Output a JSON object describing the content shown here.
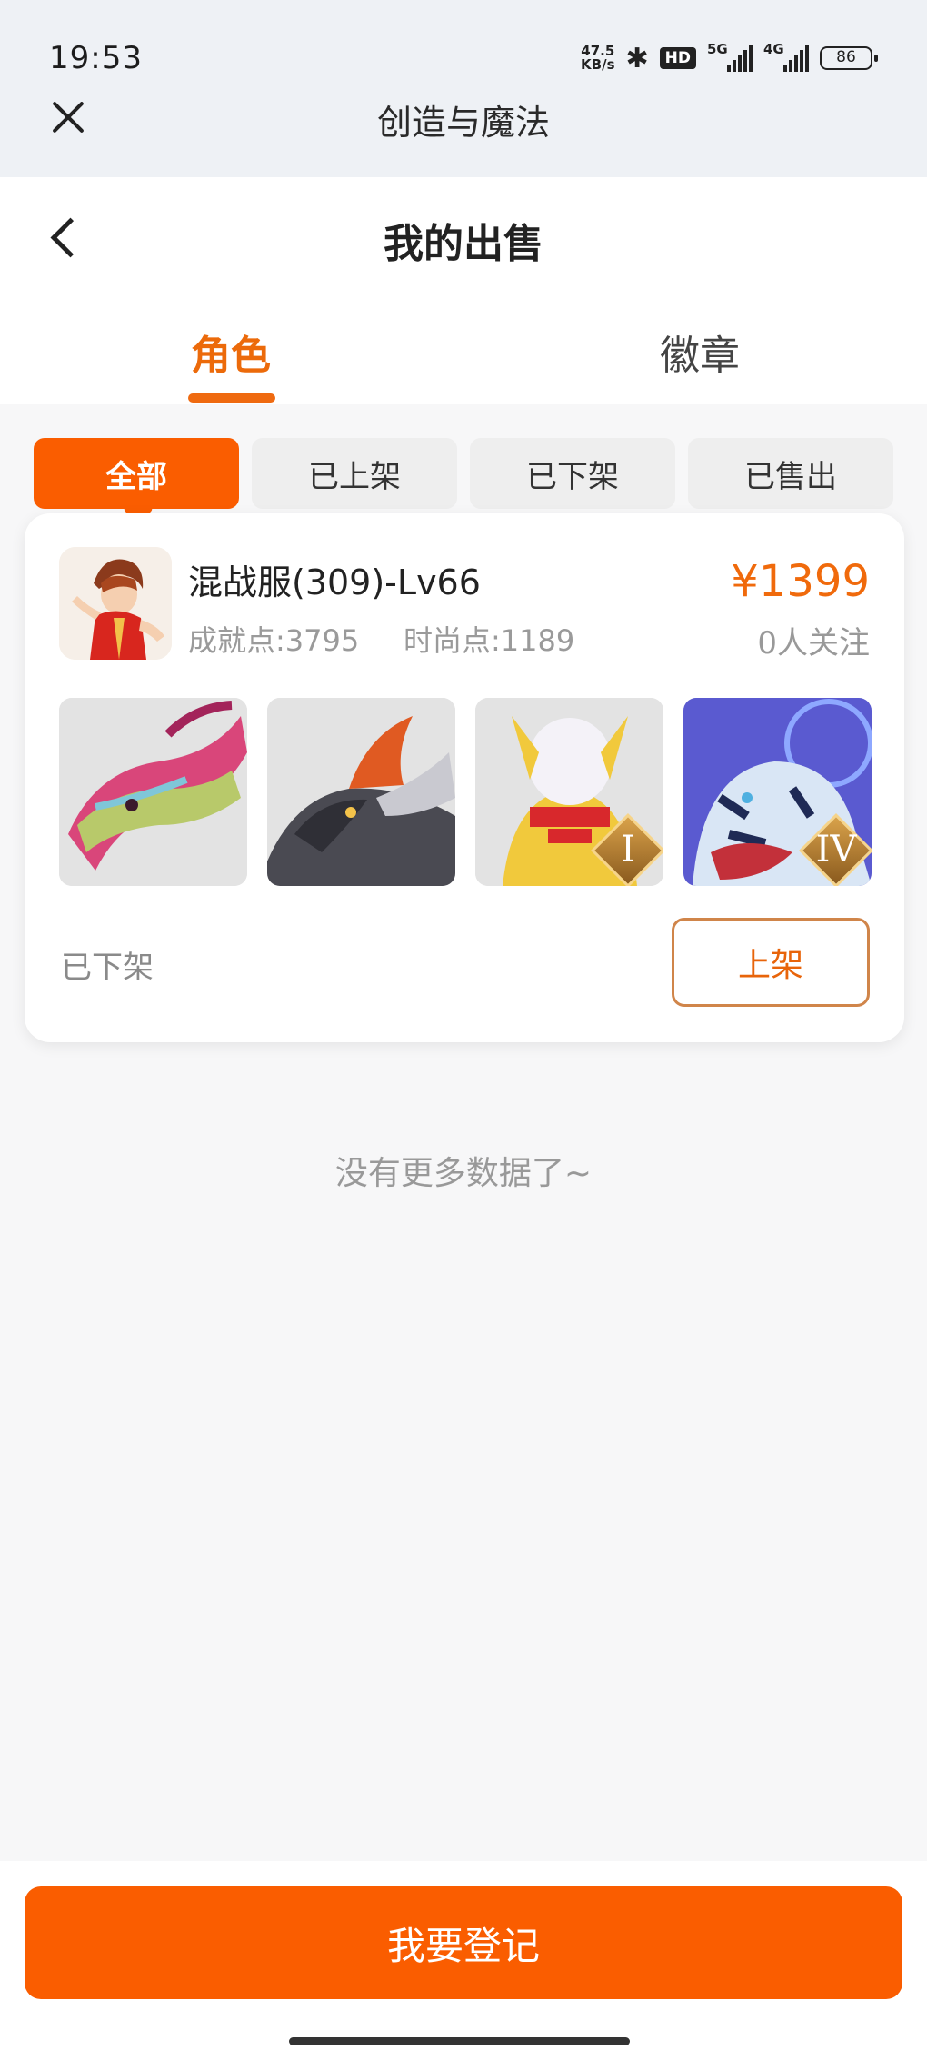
{
  "status_bar": {
    "time": "19:53",
    "net_speed_value": "47.5",
    "net_speed_unit": "KB/s",
    "hd_label": "HD",
    "sim1_label": "5G",
    "sim2_label": "4G",
    "battery": "86"
  },
  "app": {
    "title": "创造与魔法"
  },
  "page": {
    "title": "我的出售"
  },
  "tabs": [
    {
      "label": "角色",
      "active": true
    },
    {
      "label": "徽章",
      "active": false
    }
  ],
  "filters": [
    {
      "label": "全部",
      "active": true
    },
    {
      "label": "已上架",
      "active": false
    },
    {
      "label": "已下架",
      "active": false
    },
    {
      "label": "已售出",
      "active": false
    }
  ],
  "listing": {
    "name": "混战服(309)-Lv66",
    "achievement": "成就点:3795",
    "fashion": "时尚点:1189",
    "price": "¥1399",
    "follows": "0人关注",
    "status": "已下架",
    "action_label": "上架",
    "thumbnails": [
      {
        "icon": "pink-dragon-mount",
        "rank": ""
      },
      {
        "icon": "dark-dragon-mount",
        "rank": ""
      },
      {
        "icon": "golden-armor-pet",
        "rank": "I"
      },
      {
        "icon": "blue-tiger-mount",
        "rank": "IV"
      }
    ]
  },
  "footer": {
    "no_more": "没有更多数据了~",
    "register_label": "我要登记"
  },
  "colors": {
    "accent": "#fa5d00",
    "accent_text": "#f06a0c",
    "status_bar_bg": "#eef1f5"
  }
}
